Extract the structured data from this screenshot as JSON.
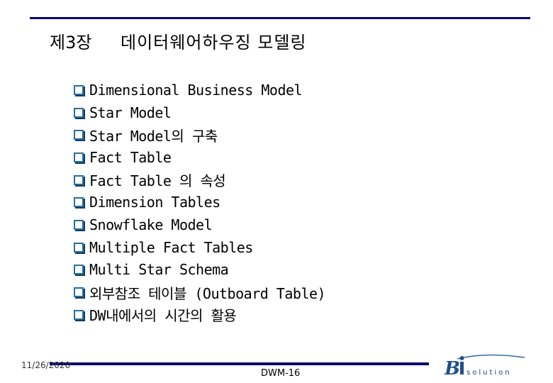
{
  "header": {
    "chapter": "제3장",
    "title": "데이터웨어하우징 모델링"
  },
  "items": [
    {
      "label": "Dimensional Business Model"
    },
    {
      "label": "Star Model"
    },
    {
      "label": "Star Model의 구축"
    },
    {
      "label": "Fact Table"
    },
    {
      "label": "Fact Table 의 속성"
    },
    {
      "label": "Dimension Tables"
    },
    {
      "label": "Snowflake Model"
    },
    {
      "label": "Multiple Fact Tables"
    },
    {
      "label": "Multi Star Schema"
    },
    {
      "label": "외부참조 테이블 (Outboard Table)"
    },
    {
      "label": "DW내에서의 시간의 활용"
    }
  ],
  "footer": {
    "date": "11/26/2020",
    "page": "DWM-16",
    "logo_text": "Bi solution"
  },
  "colors": {
    "rule": "#0a0a6e",
    "bullet": "#2a6f9a"
  }
}
